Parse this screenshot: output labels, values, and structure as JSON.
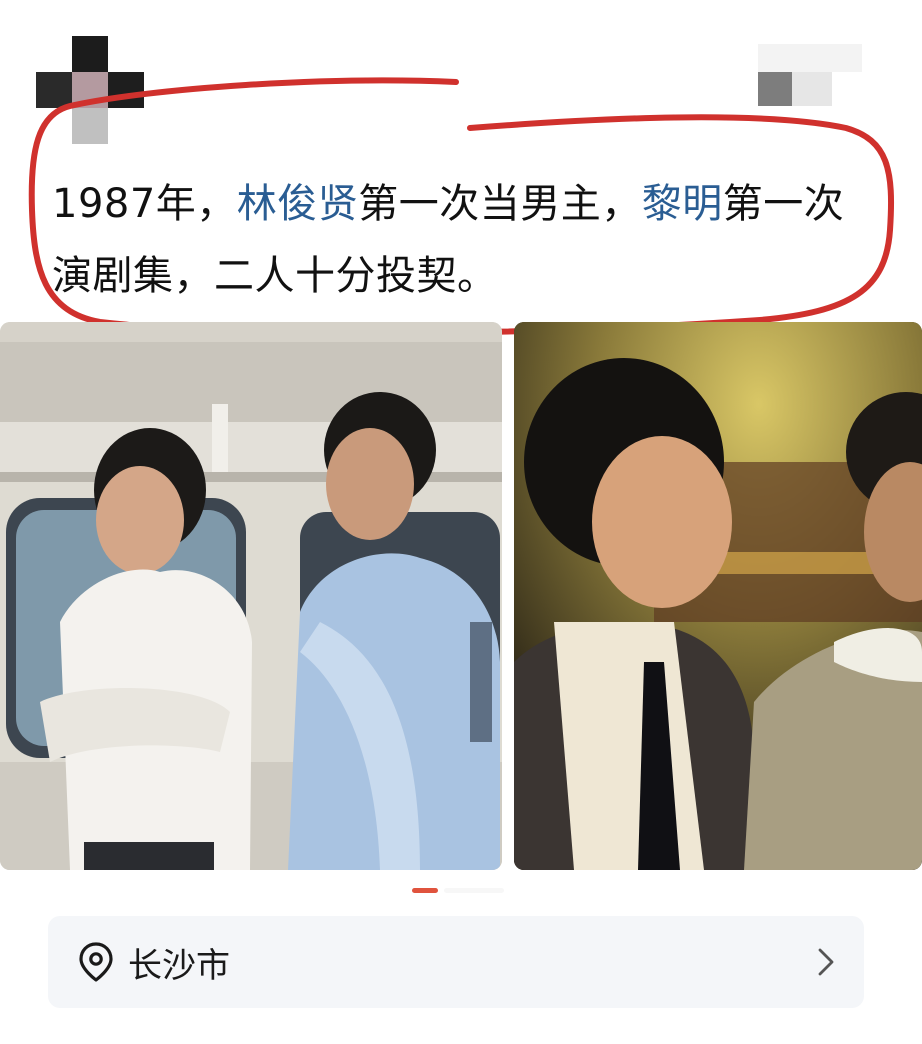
{
  "post": {
    "text_1": "1987年，",
    "mention_1": "林俊贤",
    "text_2": "第一次当男主，",
    "mention_2": "黎明",
    "text_3": "第一次演剧集，二人十分投契。",
    "mention_color": "#2a5d93",
    "highlight_color": "#d0312d"
  },
  "images": [
    {
      "icon": "photo-two-men-by-van"
    },
    {
      "icon": "photo-drama-still"
    }
  ],
  "pager": {
    "count": 2,
    "active_index": 0,
    "active_color": "#e0533d"
  },
  "location": {
    "label": "长沙市",
    "icon": "location-pin-icon",
    "action_icon": "chevron-right-icon"
  }
}
